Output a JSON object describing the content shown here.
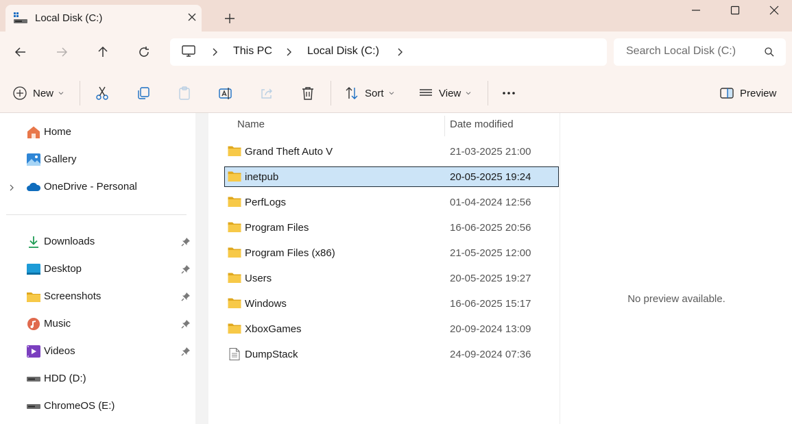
{
  "window": {
    "tab_title": "Local Disk (C:)"
  },
  "address": {
    "crumbs": [
      "This PC",
      "Local Disk (C:)"
    ],
    "search_placeholder": "Search Local Disk (C:)"
  },
  "toolbar": {
    "new_label": "New",
    "sort_label": "Sort",
    "view_label": "View",
    "preview_label": "Preview"
  },
  "sidebar": {
    "items": [
      {
        "label": "Home",
        "icon": "home-icon"
      },
      {
        "label": "Gallery",
        "icon": "gallery-icon"
      },
      {
        "label": "OneDrive - Personal",
        "icon": "onedrive-icon"
      },
      {
        "label": "Downloads",
        "icon": "download-icon",
        "pinned": true
      },
      {
        "label": "Desktop",
        "icon": "desktop-icon",
        "pinned": true
      },
      {
        "label": "Screenshots",
        "icon": "folder-icon",
        "pinned": true
      },
      {
        "label": "Music",
        "icon": "music-icon",
        "pinned": true
      },
      {
        "label": "Videos",
        "icon": "videos-icon",
        "pinned": true
      },
      {
        "label": "HDD (D:)",
        "icon": "drive-icon"
      },
      {
        "label": "ChromeOS (E:)",
        "icon": "drive-icon"
      }
    ]
  },
  "files": {
    "columns": [
      "Name",
      "Date modified"
    ],
    "rows": [
      {
        "name": "Grand Theft Auto V",
        "date": "21-03-2025 21:00",
        "type": "folder"
      },
      {
        "name": "inetpub",
        "date": "20-05-2025 19:24",
        "type": "folder",
        "selected": true
      },
      {
        "name": "PerfLogs",
        "date": "01-04-2024 12:56",
        "type": "folder"
      },
      {
        "name": "Program Files",
        "date": "16-06-2025 20:56",
        "type": "folder"
      },
      {
        "name": "Program Files (x86)",
        "date": "21-05-2025 12:00",
        "type": "folder"
      },
      {
        "name": "Users",
        "date": "20-05-2025 19:27",
        "type": "folder"
      },
      {
        "name": "Windows",
        "date": "16-06-2025 15:17",
        "type": "folder"
      },
      {
        "name": "XboxGames",
        "date": "20-09-2024 13:09",
        "type": "folder"
      },
      {
        "name": "DumpStack",
        "date": "24-09-2024 07:36",
        "type": "file"
      }
    ]
  },
  "preview": {
    "message": "No preview available."
  },
  "colors": {
    "titlebar_bg": "#f1ddd4",
    "toolbar_bg": "#fbf3ef",
    "selection_bg": "#cce4f7",
    "folder_yellow": "#f4c542"
  }
}
